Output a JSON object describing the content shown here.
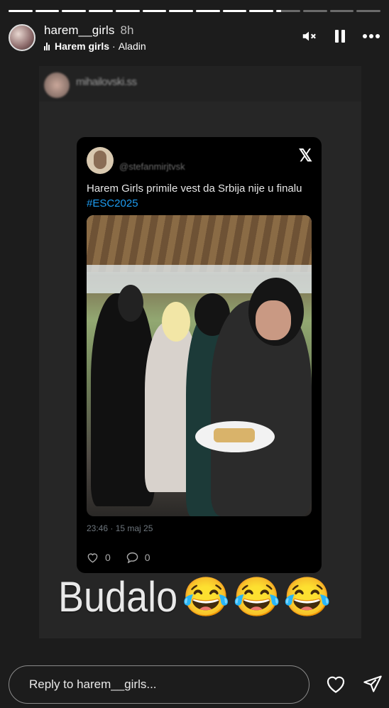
{
  "progress": {
    "segments": 14,
    "completed": 10,
    "current_fraction": 0.2
  },
  "header": {
    "username": "harem__girls",
    "time": "8h",
    "music_song": "Harem girls",
    "music_separator": "·",
    "music_artist": "Aladin",
    "icons": [
      "mute-icon",
      "pause-icon",
      "more-icon"
    ]
  },
  "shared_post": {
    "blurred_name": "mihailovski.ss"
  },
  "tweet": {
    "name": "",
    "handle": "@stefanmirjtvsk",
    "text": "Harem Girls primile vest da Srbija nije u finalu",
    "hashtag": "#ESC2025",
    "date": "23:46 · 15 maj 25",
    "likes": "0",
    "comments": "0",
    "x_logo": "𝕏"
  },
  "caption": {
    "word": "Budalo",
    "emojis": [
      "😂",
      "😂",
      "😂"
    ]
  },
  "reply": {
    "placeholder": "Reply to harem__girls..."
  },
  "colors": {
    "background": "#1c1c1c",
    "link": "#1d9bf0"
  }
}
